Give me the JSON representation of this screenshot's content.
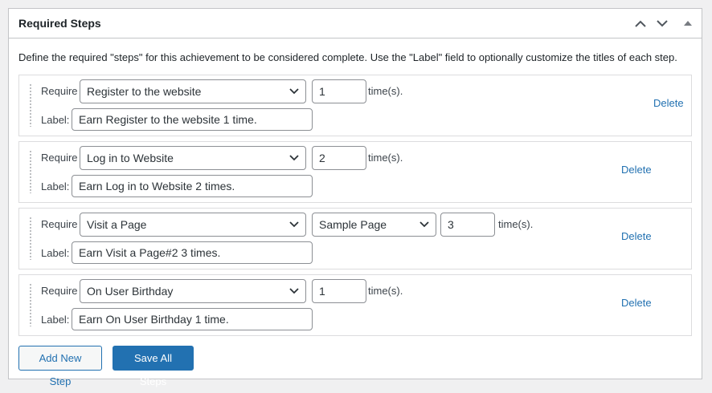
{
  "box": {
    "title": "Required Steps",
    "description": "Define the required \"steps\" for this achievement to be considered complete. Use the \"Label\" field to optionally customize the titles of each step."
  },
  "labels": {
    "require": "Require",
    "label": "Label:",
    "times": "time(s).",
    "delete": "Delete"
  },
  "steps": [
    {
      "trigger": "Register to the website",
      "count": "1",
      "label": "Earn Register to the website 1 time."
    },
    {
      "trigger": "Log in to Website",
      "count": "2",
      "label": "Earn Log in to Website 2 times."
    },
    {
      "trigger": "Visit a Page",
      "post": "Sample Page",
      "count": "3",
      "label": "Earn Visit a Page#2 3 times."
    },
    {
      "trigger": "On User Birthday",
      "count": "1",
      "label": "Earn On User Birthday 1 time."
    }
  ],
  "buttons": {
    "add": "Add New Step",
    "save": "Save All Steps"
  },
  "colors": {
    "link": "#2271b1",
    "primary": "#2271b1",
    "border": "#c3c4c7"
  },
  "icons": {
    "move_up": "chevron-up-icon",
    "move_down": "chevron-down-icon",
    "toggle": "triangle-up-icon",
    "drag": "drag-handle-icon",
    "select": "chevron-down-icon"
  }
}
